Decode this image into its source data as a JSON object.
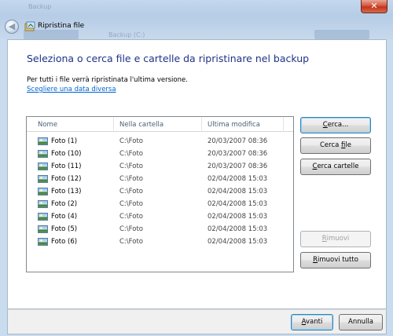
{
  "window": {
    "title": "Ripristina file",
    "close_glyph": "✕",
    "back_glyph": "◀",
    "ghost_text_1": "Backup",
    "ghost_text_2": "Backup (C:)"
  },
  "main": {
    "heading": "Seleziona o cerca file e cartelle da ripristinare nel backup",
    "note": "Per tutti i file verrà ripristinata l'ultima versione.",
    "link": "Scegliere una data diversa"
  },
  "list": {
    "columns": [
      "Nome",
      "Nella cartella",
      "Ultima modifica"
    ],
    "rows": [
      {
        "name": "Foto (1)",
        "folder": "C:\\Foto",
        "modified": "20/03/2007 08:36"
      },
      {
        "name": "Foto (10)",
        "folder": "C:\\Foto",
        "modified": "20/03/2007 08:36"
      },
      {
        "name": "Foto (11)",
        "folder": "C:\\Foto",
        "modified": "20/03/2007 08:36"
      },
      {
        "name": "Foto (12)",
        "folder": "C:\\Foto",
        "modified": "02/04/2008 15:03"
      },
      {
        "name": "Foto (13)",
        "folder": "C:\\Foto",
        "modified": "02/04/2008 15:03"
      },
      {
        "name": "Foto (2)",
        "folder": "C:\\Foto",
        "modified": "02/04/2008 15:03"
      },
      {
        "name": "Foto (4)",
        "folder": "C:\\Foto",
        "modified": "02/04/2008 15:03"
      },
      {
        "name": "Foto (5)",
        "folder": "C:\\Foto",
        "modified": "02/04/2008 15:03"
      },
      {
        "name": "Foto (6)",
        "folder": "C:\\Foto",
        "modified": "02/04/2008 15:03"
      }
    ]
  },
  "buttons": {
    "search": {
      "pre": "",
      "key": "C",
      "post": "erca..."
    },
    "search_files": {
      "pre": "Cerca ",
      "key": "f",
      "post": "ile"
    },
    "search_folders": {
      "pre": "",
      "key": "C",
      "post": "erca cartelle"
    },
    "remove": {
      "pre": "",
      "key": "R",
      "post": "imuovi"
    },
    "remove_all": {
      "pre": "",
      "key": "R",
      "post": "imuovi tutto"
    }
  },
  "footer": {
    "next": {
      "pre": "",
      "key": "A",
      "post": "vanti"
    },
    "cancel": "Annulla"
  },
  "colors": {
    "heading": "#1e3287",
    "link": "#0066cc",
    "glass": "#c4d8ee"
  }
}
